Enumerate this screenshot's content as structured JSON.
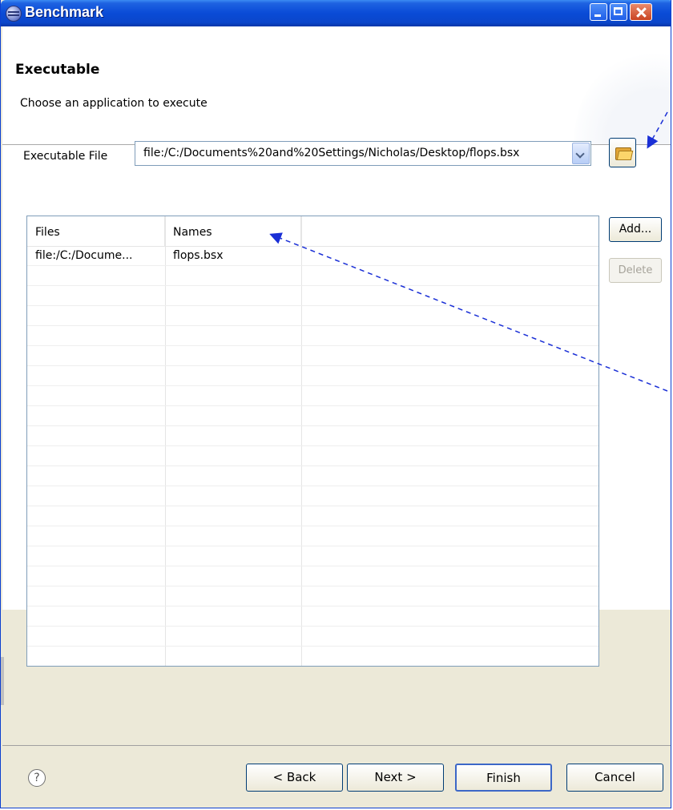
{
  "window": {
    "title": "Benchmark"
  },
  "header": {
    "title": "Executable",
    "description": "Choose an application to execute"
  },
  "executable": {
    "label": "Executable File",
    "value": "file:/C:/Documents%20and%20Settings/Nicholas/Desktop/flops.bsx"
  },
  "table": {
    "columns": [
      "Files",
      "Names",
      ""
    ],
    "rows": [
      {
        "file": "file:/C:/Docume...",
        "name": "flops.bsx"
      }
    ]
  },
  "side_buttons": {
    "add": "Add...",
    "delete": "Delete"
  },
  "footer": {
    "help": "?",
    "back": "< Back",
    "next": "Next >",
    "finish": "Finish",
    "cancel": "Cancel"
  },
  "icons": {
    "title": "eclipse-icon",
    "browse": "folder-icon",
    "help": "help-icon",
    "combo": "chevron-down-icon"
  },
  "colors": {
    "titlebar": "#0b46cb",
    "annotation_arrow": "#1a2fd6"
  }
}
